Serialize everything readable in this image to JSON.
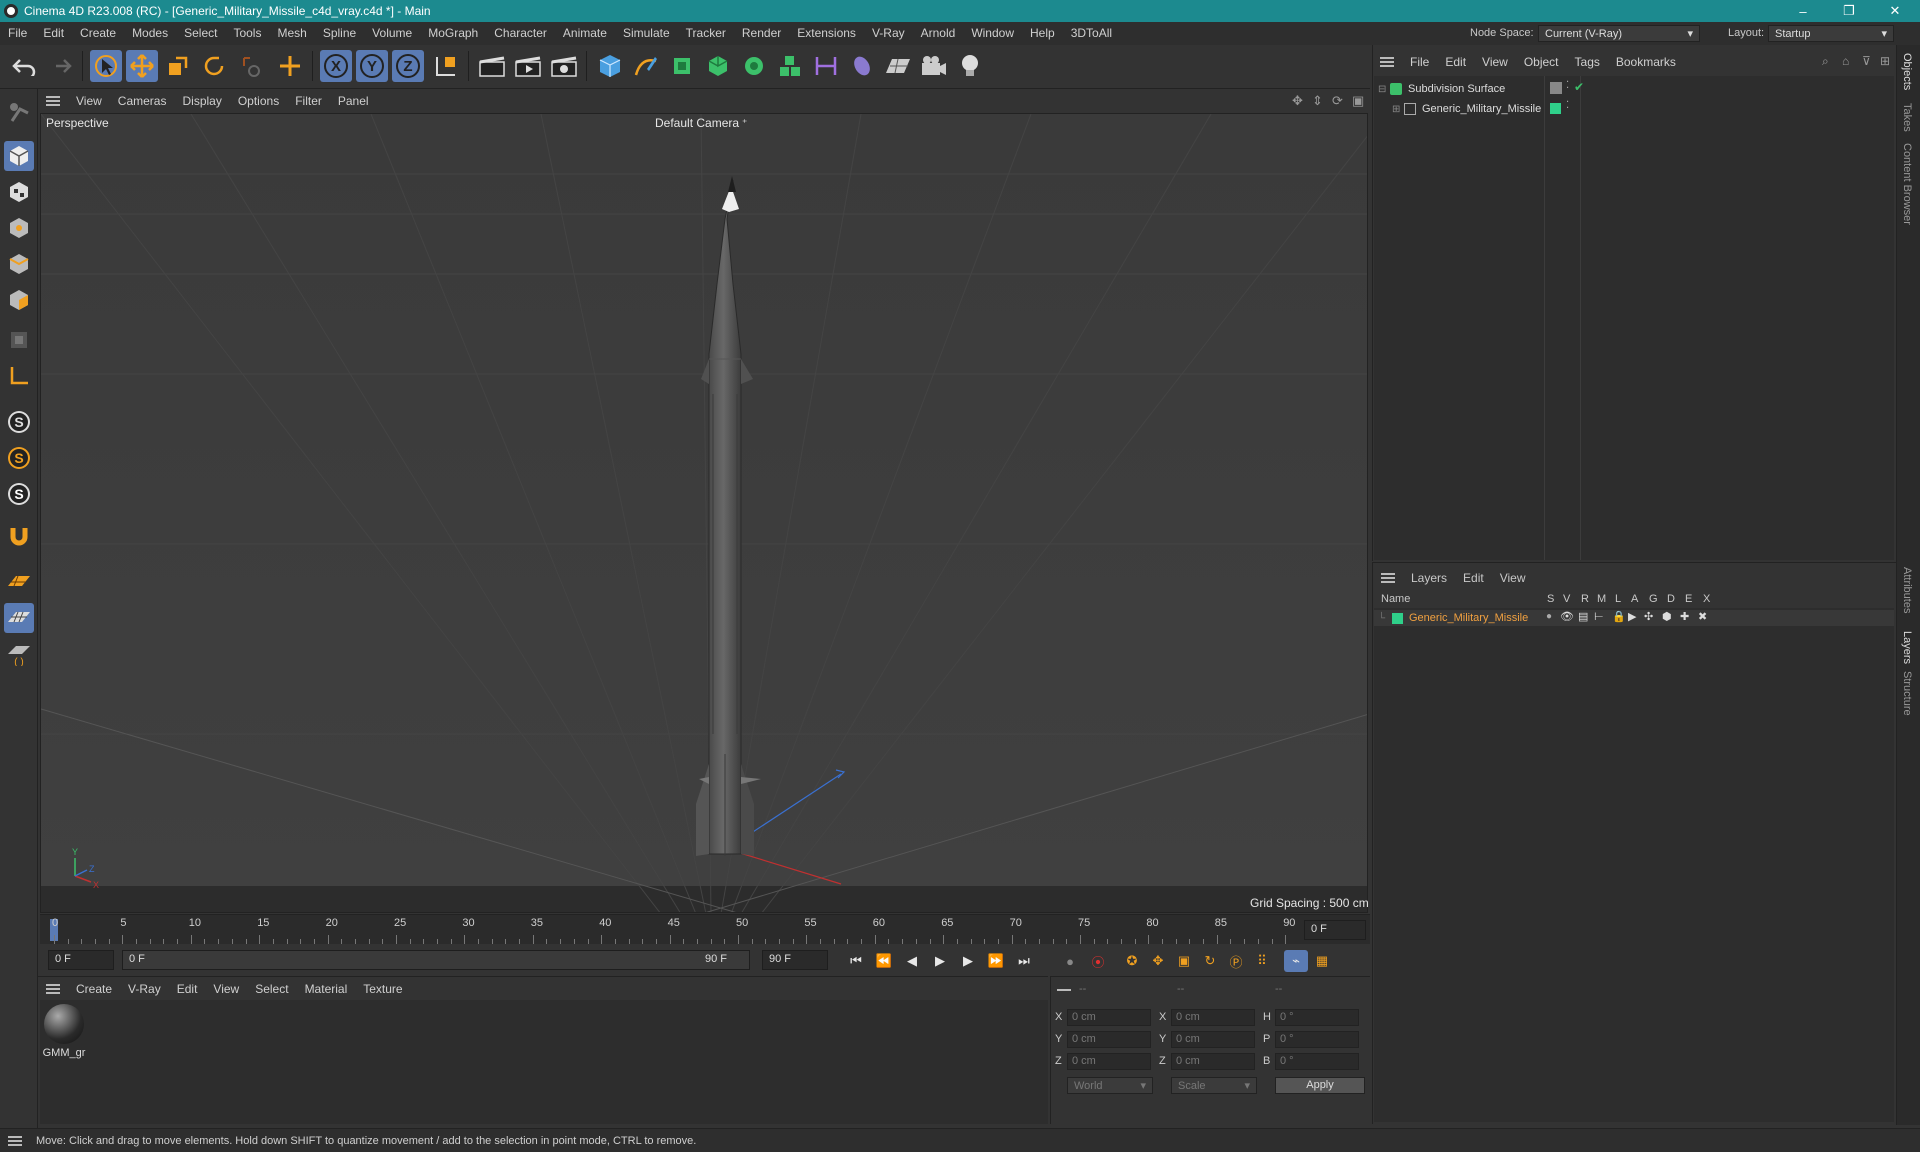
{
  "window": {
    "title": "Cinema 4D R23.008 (RC) - [Generic_Military_Missile_c4d_vray.c4d *] - Main",
    "controls": [
      "–",
      "❐",
      "✕"
    ]
  },
  "menubar": {
    "items": [
      "File",
      "Edit",
      "Create",
      "Modes",
      "Select",
      "Tools",
      "Mesh",
      "Spline",
      "Volume",
      "MoGraph",
      "Character",
      "Animate",
      "Simulate",
      "Tracker",
      "Render",
      "Extensions",
      "V-Ray",
      "Arnold",
      "Window",
      "Help",
      "3DToAll"
    ],
    "node_space_label": "Node Space:",
    "node_space_value": "Current (V-Ray)",
    "layout_label": "Layout:",
    "layout_value": "Startup"
  },
  "viewport": {
    "menu": [
      "View",
      "Cameras",
      "Display",
      "Options",
      "Filter",
      "Panel"
    ],
    "label": "Perspective",
    "camera": "Default Camera",
    "grid_spacing": "Grid Spacing : 500 cm",
    "axis": {
      "y": "Y",
      "x": "X",
      "z": "Z"
    }
  },
  "timeline": {
    "ticks": [
      "0",
      "5",
      "10",
      "15",
      "20",
      "25",
      "30",
      "35",
      "40",
      "45",
      "50",
      "55",
      "60",
      "65",
      "70",
      "75",
      "80",
      "85",
      "90"
    ],
    "current_frame": "0 F",
    "start_field": "0 F",
    "range_start": "0 F",
    "range_end": "90 F",
    "end_field": "90 F"
  },
  "material_manager": {
    "menu": [
      "Create",
      "V-Ray",
      "Edit",
      "View",
      "Select",
      "Material",
      "Texture"
    ],
    "materials": [
      {
        "name": "GMM_gr"
      }
    ]
  },
  "coordinates": {
    "headers": [
      "--",
      "--",
      "--"
    ],
    "rows": [
      {
        "a": "X",
        "a_val": "0 cm",
        "b": "X",
        "b_val": "0 cm",
        "c": "H",
        "c_val": "0 °"
      },
      {
        "a": "Y",
        "a_val": "0 cm",
        "b": "Y",
        "b_val": "0 cm",
        "c": "P",
        "c_val": "0 °"
      },
      {
        "a": "Z",
        "a_val": "0 cm",
        "b": "Z",
        "b_val": "0 cm",
        "c": "B",
        "c_val": "0 °"
      }
    ],
    "space": "World",
    "mode": "Scale",
    "apply": "Apply"
  },
  "object_manager": {
    "menu": [
      "File",
      "Edit",
      "View",
      "Object",
      "Tags",
      "Bookmarks"
    ],
    "objects": [
      {
        "name": "Subdivision Surface"
      },
      {
        "name": "Generic_Military_Missile"
      }
    ],
    "colors": {
      "layer": "#2fd08a"
    }
  },
  "layers": {
    "menu": [
      "Layers",
      "Edit",
      "View"
    ],
    "header_name": "Name",
    "columns": [
      "S",
      "V",
      "R",
      "M",
      "L",
      "A",
      "G",
      "D",
      "E",
      "X"
    ],
    "rows": [
      {
        "name": "Generic_Military_Missile"
      }
    ],
    "colors": {
      "selected_text": "#f0a040"
    }
  },
  "right_tabs": [
    "Objects",
    "Takes",
    "Content Browser",
    "Attributes",
    "Layers",
    "Structure"
  ],
  "status": "Move: Click and drag to move elements. Hold down SHIFT to quantize movement / add to the selection in point mode, CTRL to remove."
}
